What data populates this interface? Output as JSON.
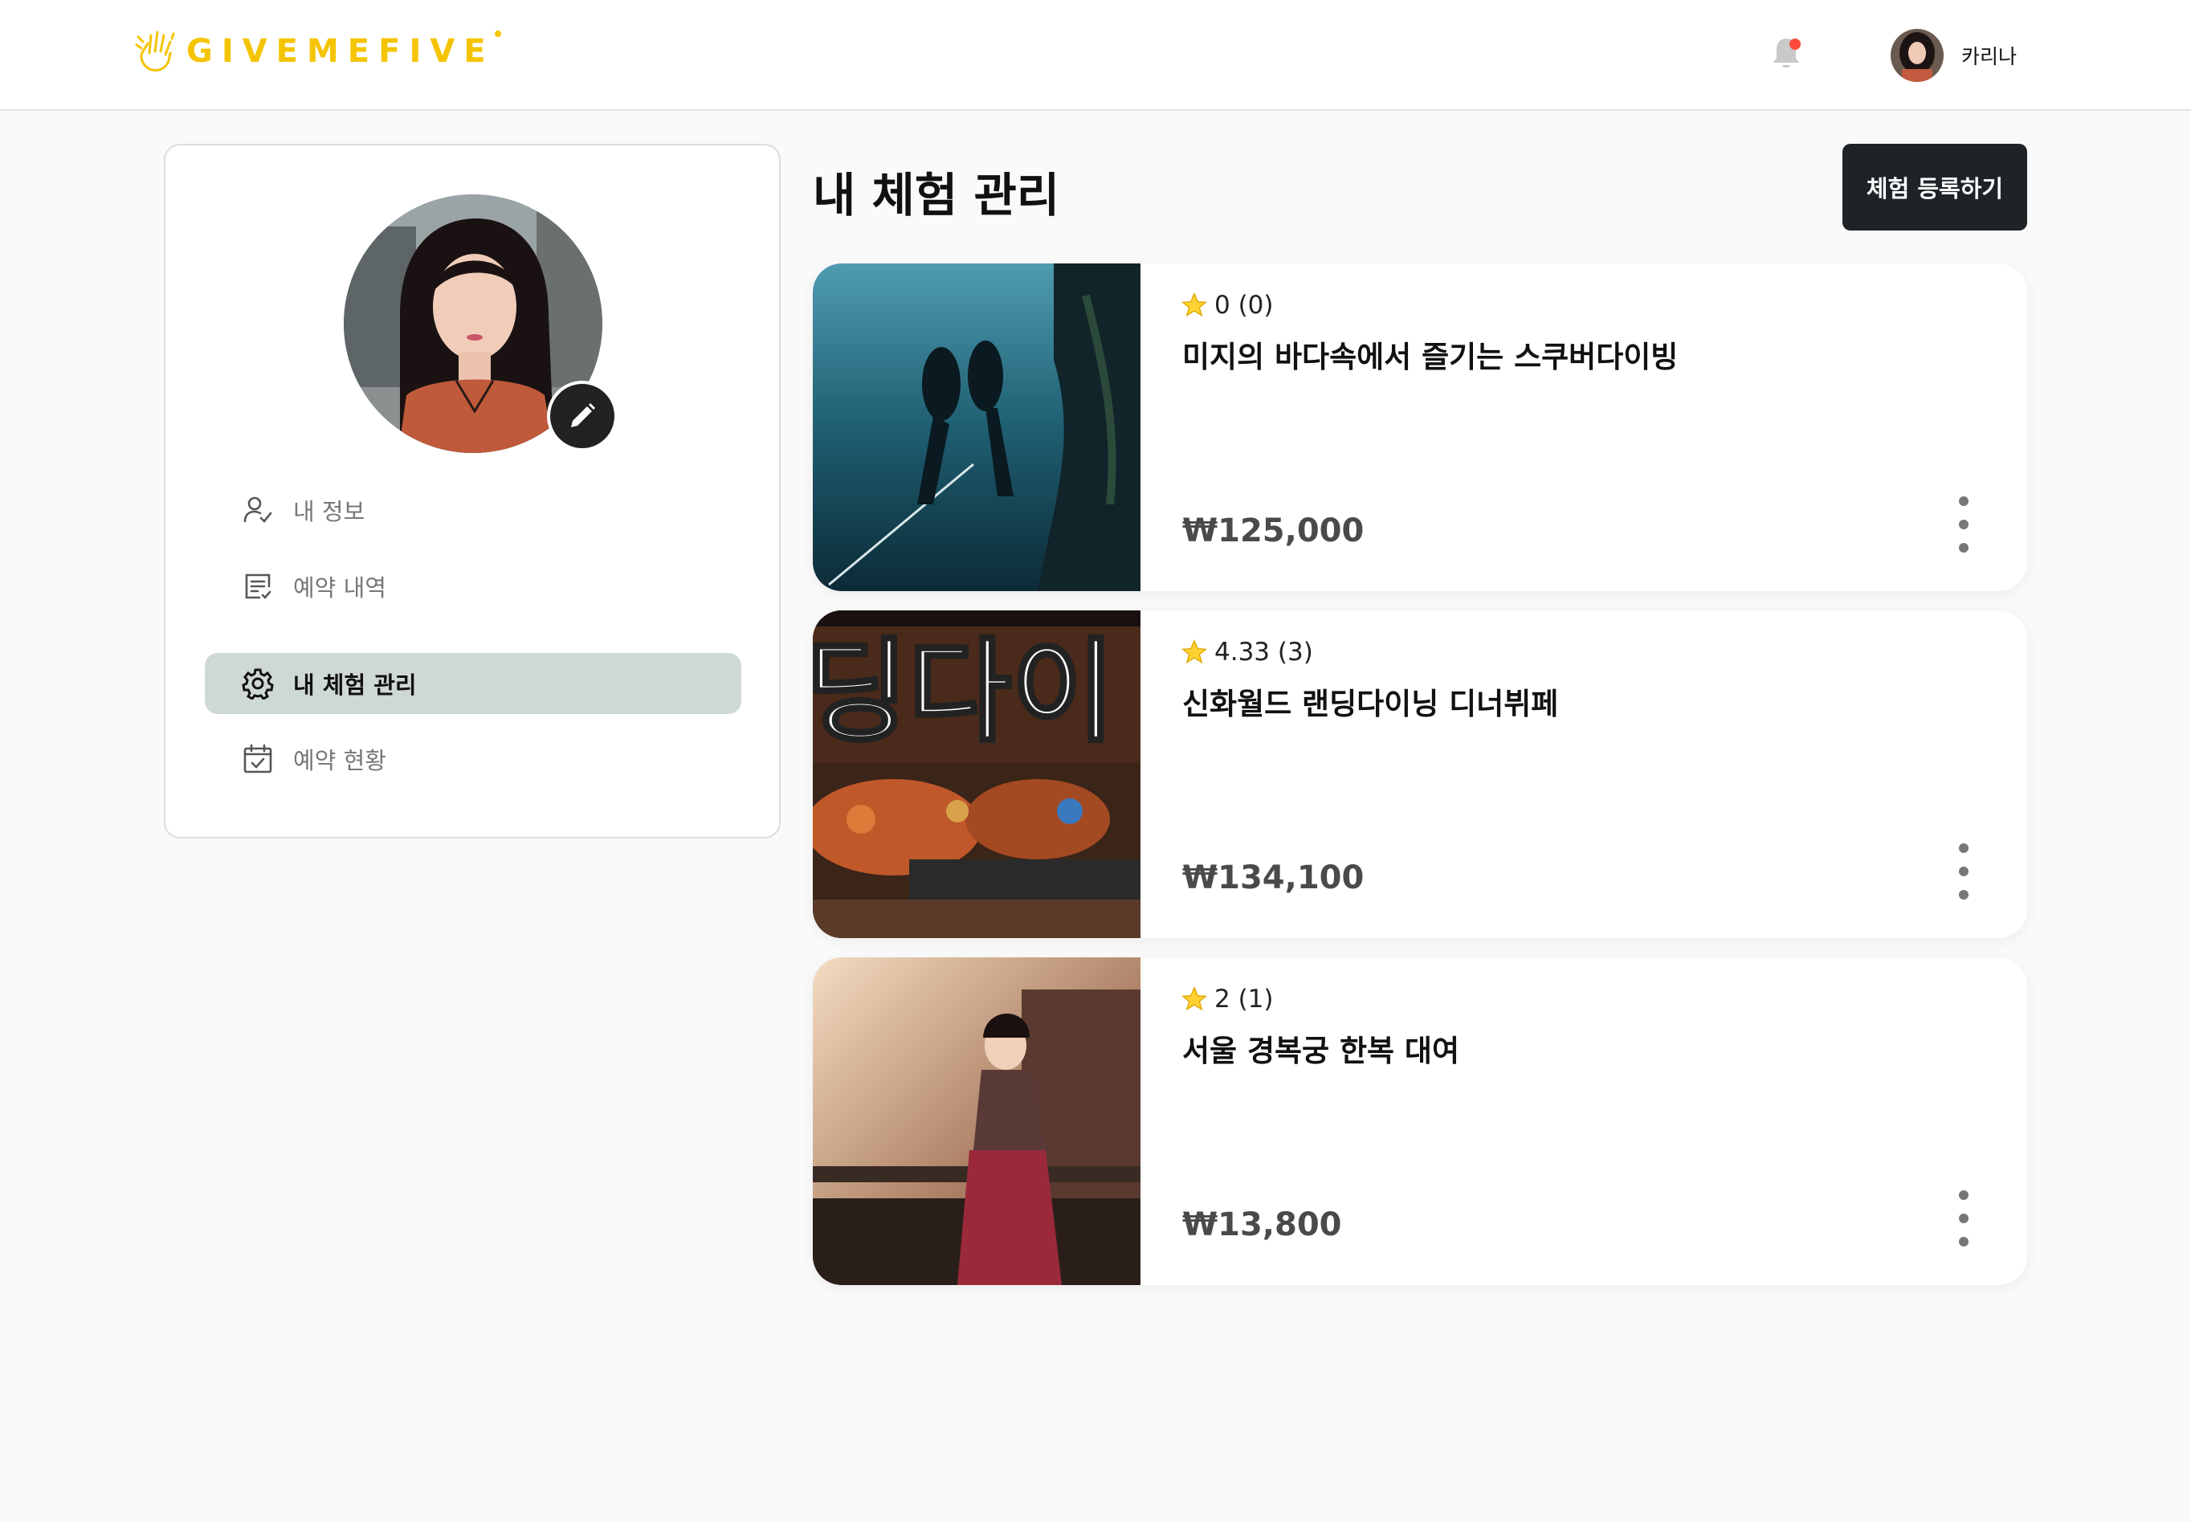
{
  "header": {
    "logo_text": "GIVEMEFIVE",
    "user_name": "카리나"
  },
  "sidebar": {
    "items": [
      {
        "label": "내 정보",
        "icon": "user-check-icon",
        "active": false
      },
      {
        "label": "예약 내역",
        "icon": "list-icon",
        "active": false
      },
      {
        "label": "내 체험 관리",
        "icon": "gear-icon",
        "active": true
      },
      {
        "label": "예약 현황",
        "icon": "calendar-check-icon",
        "active": false
      }
    ]
  },
  "main": {
    "title": "내 체험 관리",
    "add_button_label": "체험 등록하기",
    "experiences": [
      {
        "rating": "0 (0)",
        "title": "미지의 바다속에서 즐기는 스쿠버다이빙",
        "price": "₩125,000"
      },
      {
        "rating": "4.33 (3)",
        "title": "신화월드 랜딩다이닝 디너뷔페",
        "price": "₩134,100"
      },
      {
        "rating": "2 (1)",
        "title": "서울 경복궁 한복 대여",
        "price": "₩13,800"
      }
    ]
  },
  "colors": {
    "brand": "#f5c400",
    "active_menu_bg": "#cfd9d4",
    "primary_button": "#1d2326",
    "notification_dot": "#ff4a3d"
  }
}
